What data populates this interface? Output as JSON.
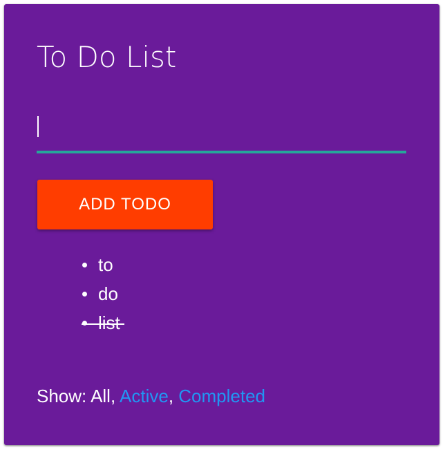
{
  "app": {
    "title": "To Do List"
  },
  "input": {
    "value": "",
    "placeholder": ""
  },
  "add_button": {
    "label": "ADD TODO"
  },
  "todos": [
    {
      "text": "to",
      "completed": false
    },
    {
      "text": "do",
      "completed": false
    },
    {
      "text": "list",
      "completed": true
    }
  ],
  "filters": {
    "prefix": "Show:",
    "all": "All",
    "active": "Active",
    "completed": "Completed",
    "separator": ","
  },
  "colors": {
    "card_background": "#6a1b9a",
    "input_underline": "#26a69a",
    "button_background": "#ff3d00",
    "link": "#2196f3",
    "text": "#ffffff"
  },
  "icons": {
    "bullet": "bullet-dot-icon"
  }
}
